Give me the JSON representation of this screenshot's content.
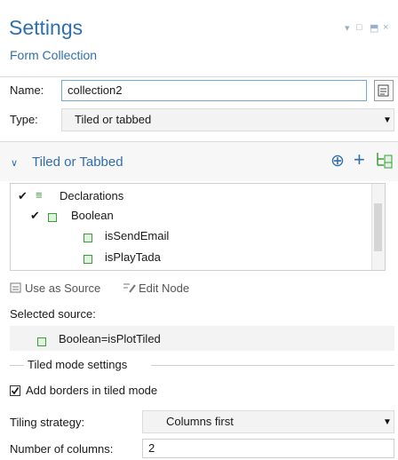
{
  "header": {
    "title": "Settings",
    "subtitle": "Form Collection",
    "window_controls": [
      "▾",
      "□",
      "⬒",
      "×"
    ]
  },
  "name_field": {
    "label": "Name:",
    "value": "collection2"
  },
  "type_field": {
    "label": "Type:",
    "value": "Tiled or tabbed"
  },
  "section": {
    "title": "Tiled or Tabbed",
    "add_label": "⊕",
    "plus_label": "+"
  },
  "tree": {
    "items": [
      {
        "label": "Declarations"
      },
      {
        "label": "Boolean"
      },
      {
        "label": "isSendEmail"
      },
      {
        "label": "isPlayTada"
      }
    ]
  },
  "actions": {
    "use_as_source": "Use as Source",
    "edit_node": "Edit Node"
  },
  "selected_source": {
    "label": "Selected source:",
    "value": "Boolean=isPlotTiled"
  },
  "tiled_settings": {
    "group_title": "Tiled mode settings",
    "borders_label": "Add borders in tiled mode",
    "borders_checked": true,
    "strategy_label": "Tiling strategy:",
    "strategy_value": "Columns first",
    "columns_label": "Number of columns:",
    "columns_value": "2"
  },
  "colors": {
    "accent": "#2f6fb0",
    "input_border": "#6fa8dc"
  }
}
